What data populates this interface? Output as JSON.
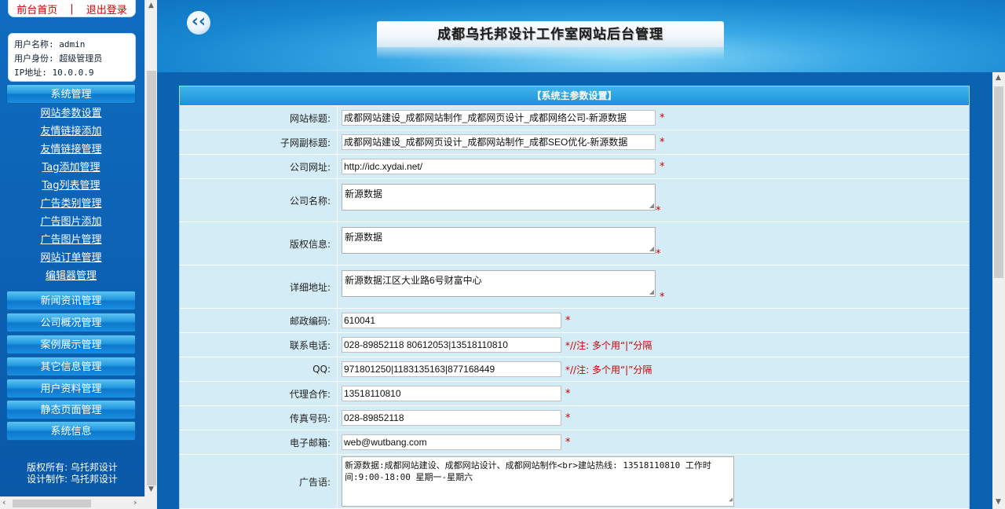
{
  "sidebar": {
    "top_links": {
      "home": "前台首页",
      "separator": "|",
      "logout": "退出登录"
    },
    "user_info": {
      "username_line": "用户名称: admin",
      "role_line": "用户身份: 超级管理员",
      "ip_line": "IP地址: 10.0.0.9"
    },
    "menu_groups": [
      {
        "label": "系统管理"
      },
      {
        "label": "新闻资讯管理"
      },
      {
        "label": "公司概况管理"
      },
      {
        "label": "案例展示管理"
      },
      {
        "label": "其它信息管理"
      },
      {
        "label": "用户资料管理"
      },
      {
        "label": "静态页面管理"
      },
      {
        "label": "系统信息"
      }
    ],
    "system_submenu": [
      "网站参数设置",
      "友情链接添加",
      "友情链接管理",
      "Tag添加管理",
      "Tag列表管理",
      "广告类别管理",
      "广告图片添加",
      "广告图片管理",
      "网站订单管理",
      "编辑器管理"
    ],
    "copyright": {
      "line1": "版权所有: 乌托邦设计",
      "line2": "设计制作: 乌托邦设计"
    }
  },
  "header": {
    "back_icon": "‹‹",
    "banner_title": "成都乌托邦设计工作室网站后台管理"
  },
  "form": {
    "title": "【系统主参数设置】",
    "required_mark": "*",
    "fields": {
      "site_title": {
        "label": "网站标题:",
        "value": "成都网站建设_成都网站制作_成都网页设计_成都网络公司-新源数据"
      },
      "sub_title": {
        "label": "子网副标题:",
        "value": "成都网站建设_成都网页设计_成都网站制作_成都SEO优化-新源数据"
      },
      "company_url": {
        "label": "公司网址:",
        "value": "http://idc.xydai.net/"
      },
      "company_name": {
        "label": "公司名称:",
        "value": "新源数据"
      },
      "copyright_info": {
        "label": "版权信息:",
        "value": "新源数据"
      },
      "address": {
        "label": "详细地址:",
        "value": "新源数据江区大业路6号财富中心"
      },
      "postcode": {
        "label": "邮政编码:",
        "value": "610041"
      },
      "phone": {
        "label": "联系电话:",
        "value": "028-89852118 80612053|13518110810",
        "note": "*//注: 多个用“|”分隔"
      },
      "qq": {
        "label": "QQ:",
        "value": "971801250|1183135163|877168449",
        "note": "*//注: 多个用“|”分隔"
      },
      "agency": {
        "label": "代理合作:",
        "value": "13518110810"
      },
      "fax": {
        "label": "传真号码:",
        "value": "028-89852118"
      },
      "email": {
        "label": "电子邮箱:",
        "value": "web@wutbang.com"
      },
      "ad_text": {
        "label": "广告语:",
        "value": "新源数据:成都网站建设、成都网站设计、成都网站制作<br>建站热线: 13518110810  工作时间:9:00-18:00 星期一-星期六"
      }
    }
  },
  "colors": {
    "sidebar_bg": "#0b62b4",
    "header_accent": "#38a8e6",
    "table_row": "#d4ecf6",
    "required": "#cc0000"
  }
}
